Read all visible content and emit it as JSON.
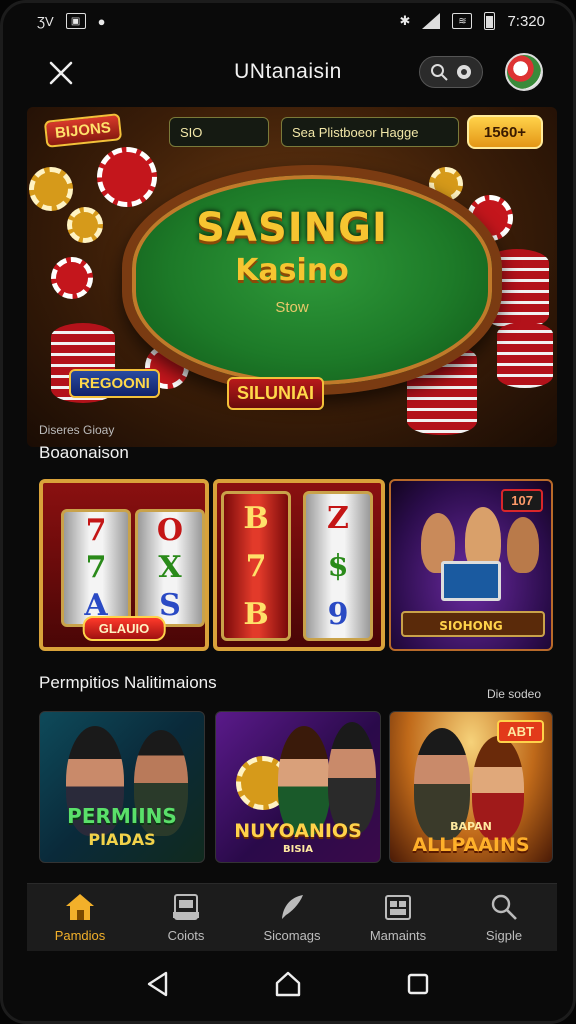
{
  "status_bar": {
    "left_text": "ƷV",
    "time": "7:320"
  },
  "header": {
    "title": "UNtanaisin"
  },
  "hero": {
    "logo": "BIJONS",
    "amount_field": "SIO",
    "search_field": "Sea Plistboeor Hagge",
    "cta_button": "1560+",
    "title": "SASINGI",
    "subtitle": "Kasino",
    "small_label": "Stow",
    "badge_left": "REGOONI",
    "badge_mid": "SILUNIAI",
    "caption": "Diseres Gioay"
  },
  "section1": {
    "title": "Boaonaison",
    "slots_badge": "GLAUIO",
    "reel1": [
      "7",
      "7",
      "A"
    ],
    "reel2": [
      "O",
      "X",
      "S"
    ],
    "reel3": [
      "B",
      "7",
      "B"
    ],
    "reel4": [
      "Z",
      "$",
      "9"
    ],
    "live_tag": "107",
    "live_label": "SIOHONG"
  },
  "section2": {
    "title": "Permpitios Nalitimaions",
    "link": "Die sodeo",
    "promos": [
      {
        "label": "PERMIINS",
        "sublabel": "PIADAS",
        "tag": ""
      },
      {
        "label": "NUYOANIOS",
        "sublabel": "BISIA",
        "tag": ""
      },
      {
        "label": "ALLPAAINS",
        "sublabel": "BAPAN",
        "tag": "ABT"
      }
    ]
  },
  "bottom_nav": [
    {
      "label": "Pamdios",
      "icon": "home-icon"
    },
    {
      "label": "Coiots",
      "icon": "slot-machine-icon"
    },
    {
      "label": "Sicomags",
      "icon": "feather-icon"
    },
    {
      "label": "Mamaints",
      "icon": "calendar-icon"
    },
    {
      "label": "Sigple",
      "icon": "search-icon"
    }
  ],
  "colors": {
    "accent": "#f2b02a",
    "felt": "#1d7a28",
    "gold": "#f6c531"
  }
}
